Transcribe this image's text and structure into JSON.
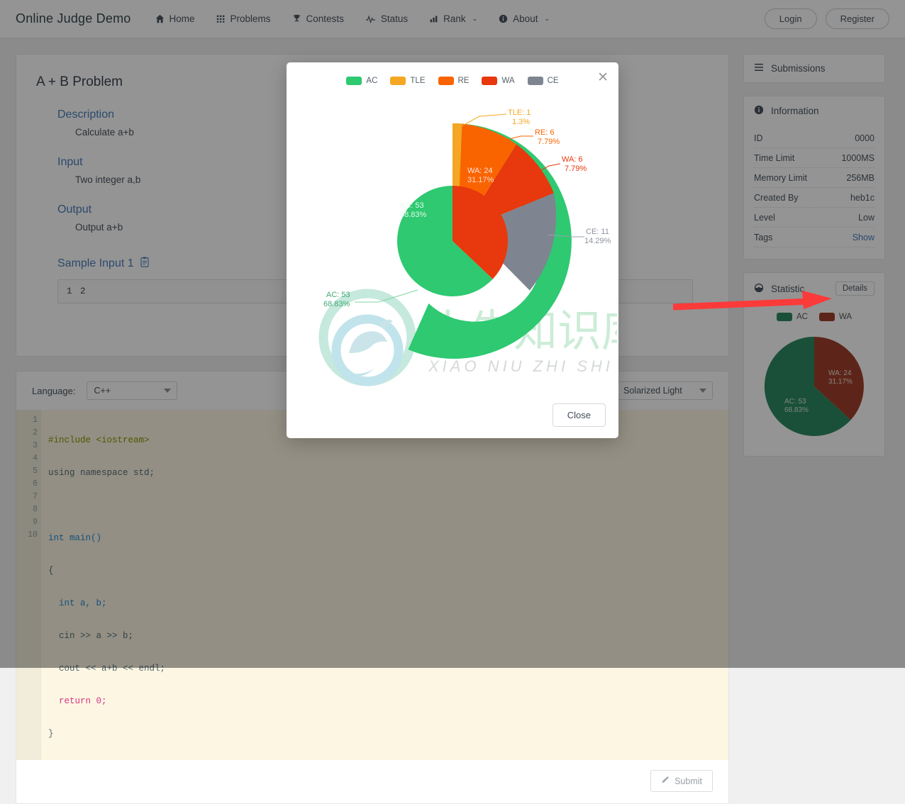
{
  "navbar": {
    "brand": "Online Judge Demo",
    "items": [
      {
        "label": "Home",
        "icon": "home-icon",
        "caret": ""
      },
      {
        "label": "Problems",
        "icon": "grid-icon",
        "caret": ""
      },
      {
        "label": "Contests",
        "icon": "trophy-icon",
        "caret": ""
      },
      {
        "label": "Status",
        "icon": "pulse-icon",
        "caret": ""
      },
      {
        "label": "Rank",
        "icon": "bar-chart-icon",
        "caret": "⌄"
      },
      {
        "label": "About",
        "icon": "info-icon",
        "caret": "⌄"
      }
    ],
    "login_label": "Login",
    "register_label": "Register"
  },
  "problem": {
    "title": "A + B Problem",
    "sections": [
      {
        "heading": "Description",
        "body": "Calculate a+b"
      },
      {
        "heading": "Input",
        "body": "Two integer a,b"
      },
      {
        "heading": "Output",
        "body": "Output a+b"
      }
    ],
    "sample": {
      "heading": "Sample Input 1",
      "copy_icon": "clipboard-icon",
      "value": "1 2"
    }
  },
  "editor": {
    "language_label": "Language:",
    "language_value": "C++",
    "theme_value": "Solarized Light",
    "submit_label": "Submit",
    "submit_icon": "pencil-icon",
    "line_numbers": [
      "1",
      "2",
      "3",
      "4",
      "5",
      "6",
      "7",
      "8",
      "9",
      "10"
    ],
    "fold_lines": [
      "1",
      "5"
    ],
    "code_lines": [
      "#include <iostream>",
      "using namespace std;",
      "",
      "int main()",
      "{",
      "  int a, b;",
      "  cin >> a >> b;",
      "  cout << a+b << endl;",
      "  return 0;",
      "}"
    ]
  },
  "sidebar": {
    "submissions": {
      "label": "Submissions",
      "icon": "list-icon"
    },
    "information": {
      "label": "Information",
      "icon": "info-circle-icon",
      "rows": [
        {
          "key": "ID",
          "value": "0000",
          "link": false
        },
        {
          "key": "Time Limit",
          "value": "1000MS",
          "link": false
        },
        {
          "key": "Memory Limit",
          "value": "256MB",
          "link": false
        },
        {
          "key": "Created By",
          "value": "heb1c",
          "link": false
        },
        {
          "key": "Level",
          "value": "Low",
          "link": false
        },
        {
          "key": "Tags",
          "value": "Show",
          "link": true
        }
      ]
    },
    "statistic": {
      "label": "Statistic",
      "icon": "chart-icon",
      "details_label": "Details"
    }
  },
  "modal": {
    "close_icon": "close-icon",
    "close_label": "Close",
    "legend": [
      {
        "label": "AC",
        "color": "#2ec971"
      },
      {
        "label": "TLE",
        "color": "#f5a623"
      },
      {
        "label": "RE",
        "color": "#fa6400"
      },
      {
        "label": "WA",
        "color": "#e8380d"
      },
      {
        "label": "CE",
        "color": "#7e8590"
      }
    ]
  },
  "watermark": {
    "chinese": "小牛知识库",
    "pinyin": "XIAO NIU ZHI SHI KU"
  },
  "chart_data": [
    {
      "type": "pie",
      "name": "modal-outer-ring",
      "title": "",
      "legend_position": "top",
      "grid": false,
      "donut": true,
      "start_angle": -90,
      "labels": [
        "AC",
        "TLE",
        "RE",
        "WA",
        "CE"
      ],
      "values": [
        53,
        1,
        6,
        6,
        11
      ],
      "percents": [
        "68.83%",
        "1.3%",
        "7.79%",
        "7.79%",
        "14.29%"
      ],
      "label_texts": [
        "AC: 53",
        "TLE: 1",
        "RE: 6",
        "WA: 6",
        "CE: 11"
      ],
      "colors": [
        "#2ec971",
        "#f5a623",
        "#fa6400",
        "#e8380d",
        "#7e8590"
      ]
    },
    {
      "type": "pie",
      "name": "modal-inner-pie",
      "title": "",
      "legend_position": "none",
      "grid": false,
      "donut": false,
      "start_angle": -90,
      "labels": [
        "AC",
        "WA"
      ],
      "values": [
        53,
        24
      ],
      "percents": [
        "68.83%",
        "31.17%"
      ],
      "label_texts": [
        "AC: 53",
        "WA: 24"
      ],
      "colors": [
        "#2ec971",
        "#e8380d"
      ]
    },
    {
      "type": "pie",
      "name": "sidebar-statistic-pie",
      "title": "",
      "legend_position": "top",
      "grid": false,
      "donut": false,
      "start_angle": -90,
      "labels": [
        "AC",
        "WA"
      ],
      "values": [
        53,
        24
      ],
      "percents": [
        "68.83%",
        "31.17%"
      ],
      "label_texts": [
        "AC: 53",
        "WA: 24"
      ],
      "colors": [
        "#2e8b62",
        "#a0402c"
      ]
    }
  ]
}
